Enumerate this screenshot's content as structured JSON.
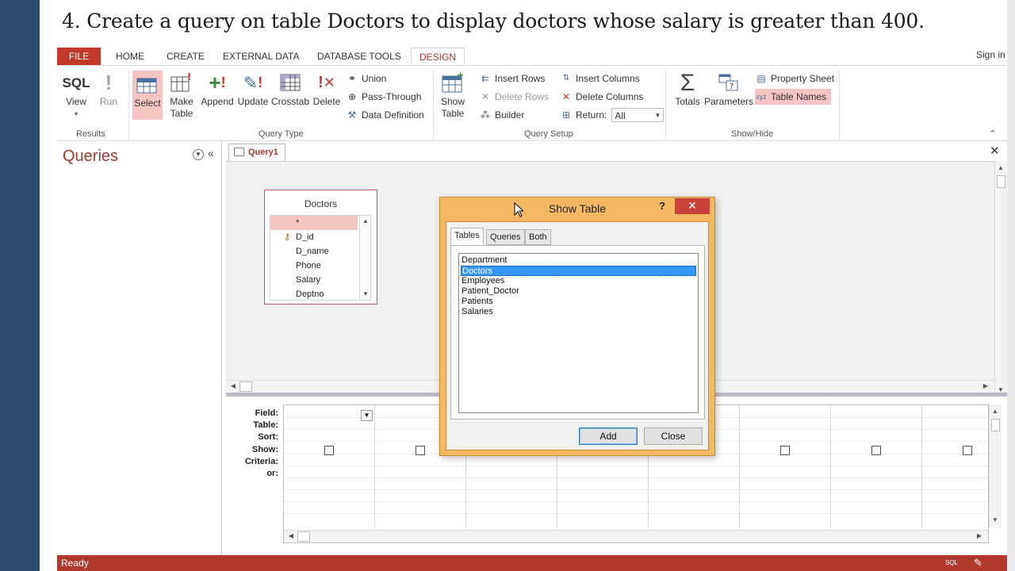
{
  "slide": {
    "title": "4.  Create a query on table Doctors to display doctors whose salary is greater than 400."
  },
  "ribbon": {
    "tabs": [
      "FILE",
      "HOME",
      "CREATE",
      "EXTERNAL DATA",
      "DATABASE TOOLS",
      "DESIGN"
    ],
    "sign_in": "Sign in",
    "groups": {
      "results": {
        "label": "Results",
        "view": {
          "icon_text": "SQL",
          "label": "View"
        },
        "run": {
          "label": "Run"
        }
      },
      "query_type": {
        "label": "Query Type",
        "select": "Select",
        "make_table_1": "Make",
        "make_table_2": "Table",
        "append": "Append",
        "update": "Update",
        "crosstab": "Crosstab",
        "delete": "Delete",
        "union": "Union",
        "pass_through": "Pass-Through",
        "data_definition": "Data Definition"
      },
      "query_setup": {
        "label": "Query Setup",
        "show_table_1": "Show",
        "show_table_2": "Table",
        "insert_rows": "Insert Rows",
        "delete_rows": "Delete Rows",
        "builder": "Builder",
        "insert_columns": "Insert Columns",
        "delete_columns": "Delete Columns",
        "return_label": "Return:",
        "return_value": "All"
      },
      "show_hide": {
        "label": "Show/Hide",
        "totals": "Totals",
        "parameters": "Parameters",
        "property_sheet": "Property Sheet",
        "table_names": "Table Names"
      }
    }
  },
  "nav": {
    "title": "Queries"
  },
  "document": {
    "tab_label": "Query1",
    "table_box": {
      "title": "Doctors",
      "fields": [
        "*",
        "D_id",
        "D_name",
        "Phone",
        "Salary",
        "Deptno"
      ]
    },
    "grid": {
      "row_labels": [
        "Field:",
        "Table:",
        "Sort:",
        "Show:",
        "Criteria:",
        "or:"
      ]
    }
  },
  "dialog": {
    "title": "Show Table",
    "help": "?",
    "tabs": [
      "Tables",
      "Queries",
      "Both"
    ],
    "items": [
      "Department",
      "Doctors",
      "Employees",
      "Patient_Doctor",
      "Patients",
      "Salaries"
    ],
    "selected": "Doctors",
    "add_label": "Add",
    "close_label": "Close"
  },
  "status": {
    "text": "Ready",
    "sql_label": "SQL"
  },
  "colors": {
    "accent": "#b0392b",
    "dialog_frame": "#f5b862",
    "selection": "#3399ff",
    "highlight": "#f7c4c4"
  }
}
